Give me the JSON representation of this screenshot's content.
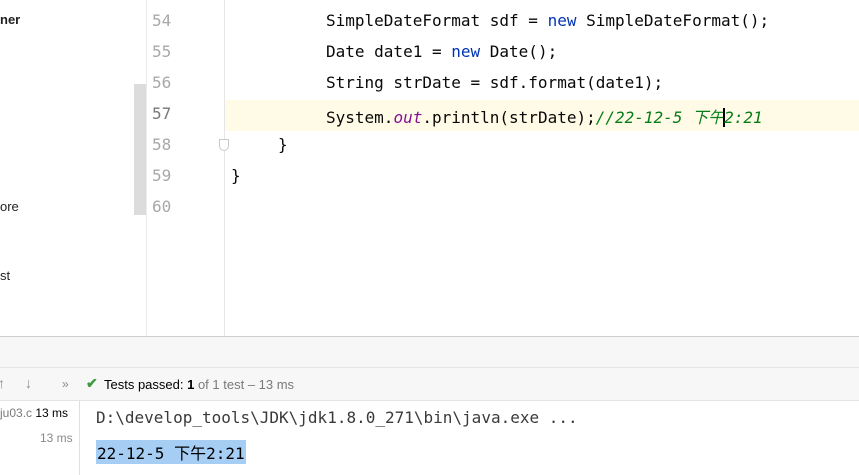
{
  "project_tree": {
    "items": [
      {
        "label": "ner",
        "bold": true
      },
      {
        "label": "ore",
        "bold": false
      },
      {
        "label": "st",
        "bold": false
      }
    ]
  },
  "editor": {
    "line_numbers": [
      "54",
      "55",
      "56",
      "57",
      "58",
      "59",
      "60"
    ],
    "current_line": "57",
    "lines": {
      "l54": {
        "type": "SimpleDateFormat sdf = ",
        "kw_new": "new",
        "ctor": " SimpleDateFormat();"
      },
      "l55": {
        "type": "Date date1 = ",
        "kw_new": "new",
        "ctor": " Date();"
      },
      "l56": {
        "text": "String strDate = sdf.format(date1);"
      },
      "l57": {
        "prefix": "System.",
        "field": "out",
        "call": ".println(strDate);",
        "comment_a": "//22-12-5 下午",
        "comment_b": "2:21"
      },
      "l58": {
        "text": "}"
      },
      "l59": {
        "text": "}"
      }
    }
  },
  "run": {
    "status_prefix": "Tests passed: ",
    "passed": "1",
    "status_rest": " of 1 test – 13 ms",
    "test_tree": [
      {
        "name": "ju03.c",
        "time": "13 ms"
      },
      {
        "name": "",
        "time": "13 ms"
      }
    ],
    "console": {
      "command": "D:\\develop_tools\\JDK\\jdk1.8.0_271\\bin\\java.exe ...",
      "output": "22-12-5 下午2:21"
    }
  },
  "colors": {
    "keyword": "#0033b3",
    "field": "#871094",
    "comment": "#067d17",
    "selection": "#a6cdf4",
    "pass": "#3d9a42"
  }
}
